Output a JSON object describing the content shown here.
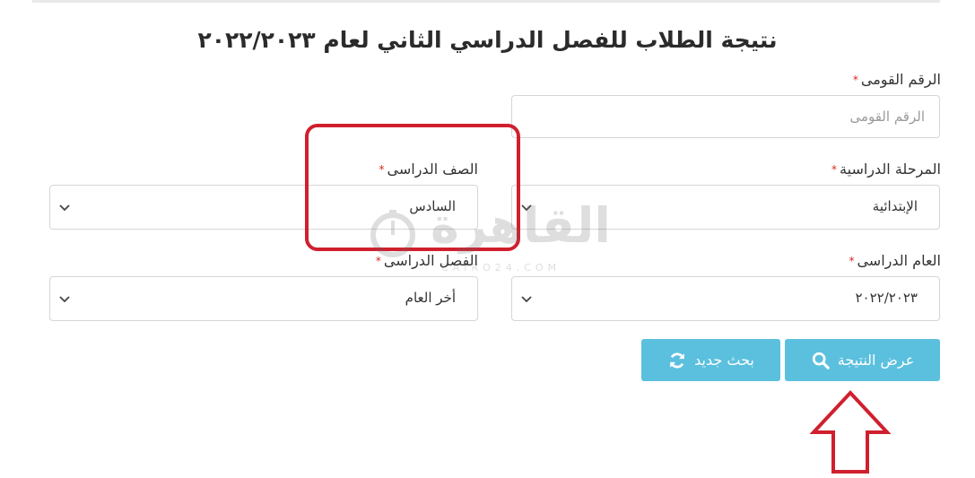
{
  "title": "نتيجة الطلاب للفصل الدراسي الثاني لعام ٢٠٢٢/٢٠٢٣",
  "required_mark": "*",
  "national_id": {
    "label": "الرقم القومى",
    "placeholder": "الرقم القومى",
    "value": ""
  },
  "stage": {
    "label": "المرحلة الدراسية",
    "value": "الإبتدائية"
  },
  "grade": {
    "label": "الصف الدراسى",
    "value": "السادس"
  },
  "year": {
    "label": "العام الدراسى",
    "value": "٢٠٢٢/٢٠٢٣"
  },
  "term": {
    "label": "الفصل الدراسى",
    "value": "أخر العام"
  },
  "buttons": {
    "show_result": "عرض النتيجة",
    "new_search": "بحث جديد"
  },
  "watermark": {
    "arabic": "القاهرة",
    "latin": "CAIRO24.COM"
  },
  "colors": {
    "button": "#5bc0de",
    "highlight": "#d01f2e",
    "required": "#d9261c",
    "border": "#d6d6d6"
  },
  "icons": {
    "show_result": "search-icon",
    "new_search": "refresh-icon",
    "select": "chevron-down-icon",
    "annotation": "up-arrow-icon"
  }
}
